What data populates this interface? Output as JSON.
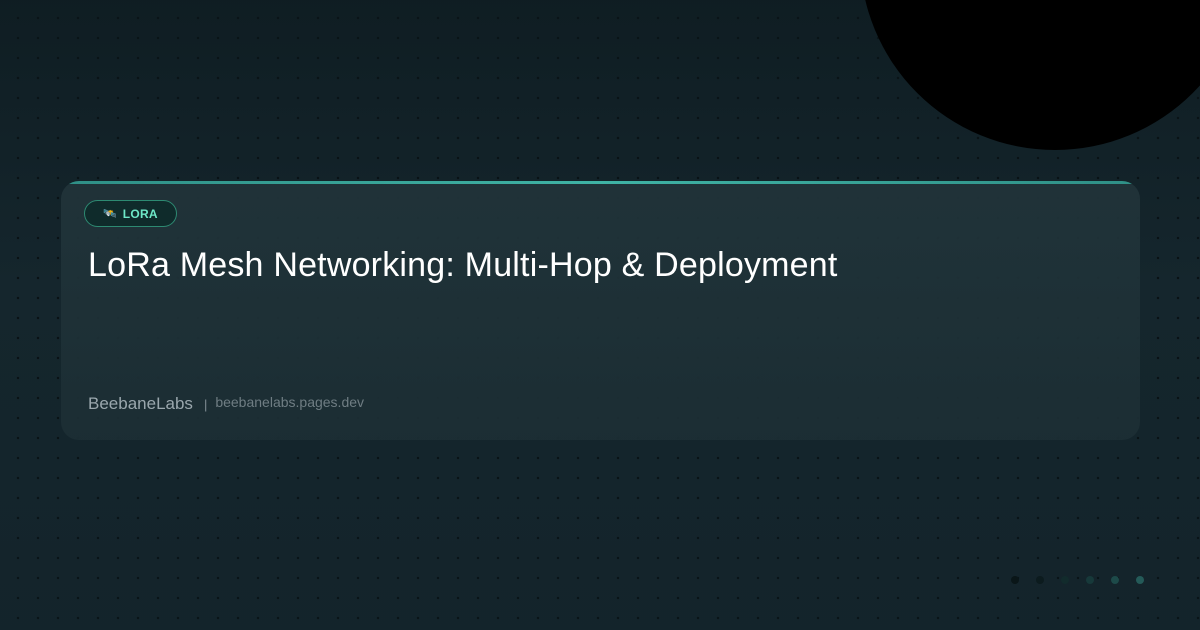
{
  "tag": {
    "icon": "🛰️",
    "icon_name": "antenna-icon",
    "label": "LORA"
  },
  "title": "LoRa Mesh Networking: Multi-Hop & Deployment",
  "footer": {
    "brand": "BeebaneLabs",
    "separator": "|",
    "domain": "beebanelabs.pages.dev"
  },
  "colors": {
    "background": "#15262d",
    "card": "#1f343a",
    "accent": "#3fb3a5",
    "tag_text": "#6ee8c8",
    "corner_circle": "#000000"
  },
  "pager_dots": [
    {
      "color": "#0a1618"
    },
    {
      "color": "#0c1b1e"
    },
    {
      "color": "#122b2c"
    },
    {
      "color": "#17393a"
    },
    {
      "color": "#1d4a49"
    },
    {
      "color": "#245a58"
    }
  ]
}
